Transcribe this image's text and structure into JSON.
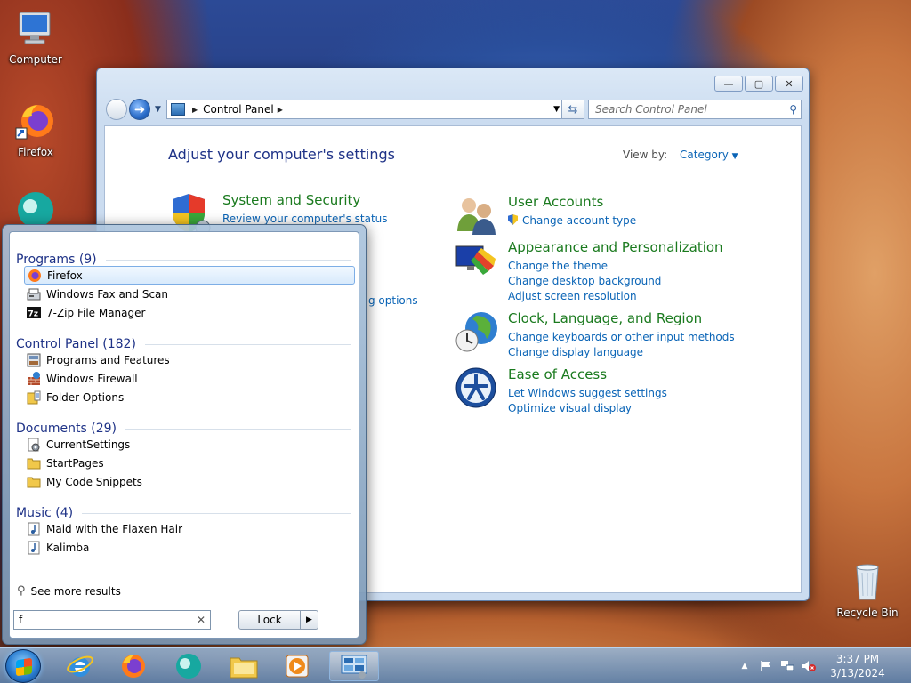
{
  "desktop": {
    "icons": [
      {
        "label": "Computer"
      },
      {
        "label": "Firefox"
      },
      {
        "label": "Recycle Bin"
      }
    ]
  },
  "window": {
    "title": "Control Panel",
    "buttons": {
      "minimize": "—",
      "maximize": "▢",
      "close": "✕"
    },
    "address": {
      "root": "Control Panel"
    },
    "search_placeholder": "Search Control Panel",
    "heading": "Adjust your computer's settings",
    "view_by_label": "View by:",
    "view_by_value": "Category",
    "categories": [
      {
        "title": "System and Security",
        "links": [
          "Review your computer's status"
        ]
      },
      {
        "title": "User Accounts",
        "links": [
          "Change account type"
        ]
      },
      {
        "title": "Appearance and Personalization",
        "links": [
          "Change the theme",
          "Change desktop background",
          "Adjust screen resolution"
        ]
      },
      {
        "title": "Clock, Language, and Region",
        "links": [
          "Change keyboards or other input methods",
          "Change display language"
        ]
      },
      {
        "title": "Ease of Access",
        "links": [
          "Let Windows suggest settings",
          "Optimize visual display"
        ]
      }
    ],
    "partial_link": "g options"
  },
  "start_menu": {
    "groups": [
      {
        "heading": "Programs (9)",
        "items": [
          "Firefox",
          "Windows Fax and Scan",
          "7-Zip File Manager"
        ]
      },
      {
        "heading": "Control Panel (182)",
        "items": [
          "Programs and Features",
          "Windows Firewall",
          "Folder Options"
        ]
      },
      {
        "heading": "Documents (29)",
        "items": [
          "CurrentSettings",
          "StartPages",
          "My Code Snippets"
        ]
      },
      {
        "heading": "Music (4)",
        "items": [
          "Maid with the Flaxen Hair",
          "Kalimba"
        ]
      }
    ],
    "see_more": "See more results",
    "search_value": "f",
    "clear_glyph": "✕",
    "lock_label": "Lock",
    "lock_arrow": "▶"
  },
  "taskbar": {
    "time": "3:37 PM",
    "date": "3/13/2024",
    "tray_up": "▲"
  },
  "colors": {
    "heading_blue": "#1e3287",
    "link_blue": "#0a64b6",
    "category_green": "#1a7a1e"
  }
}
